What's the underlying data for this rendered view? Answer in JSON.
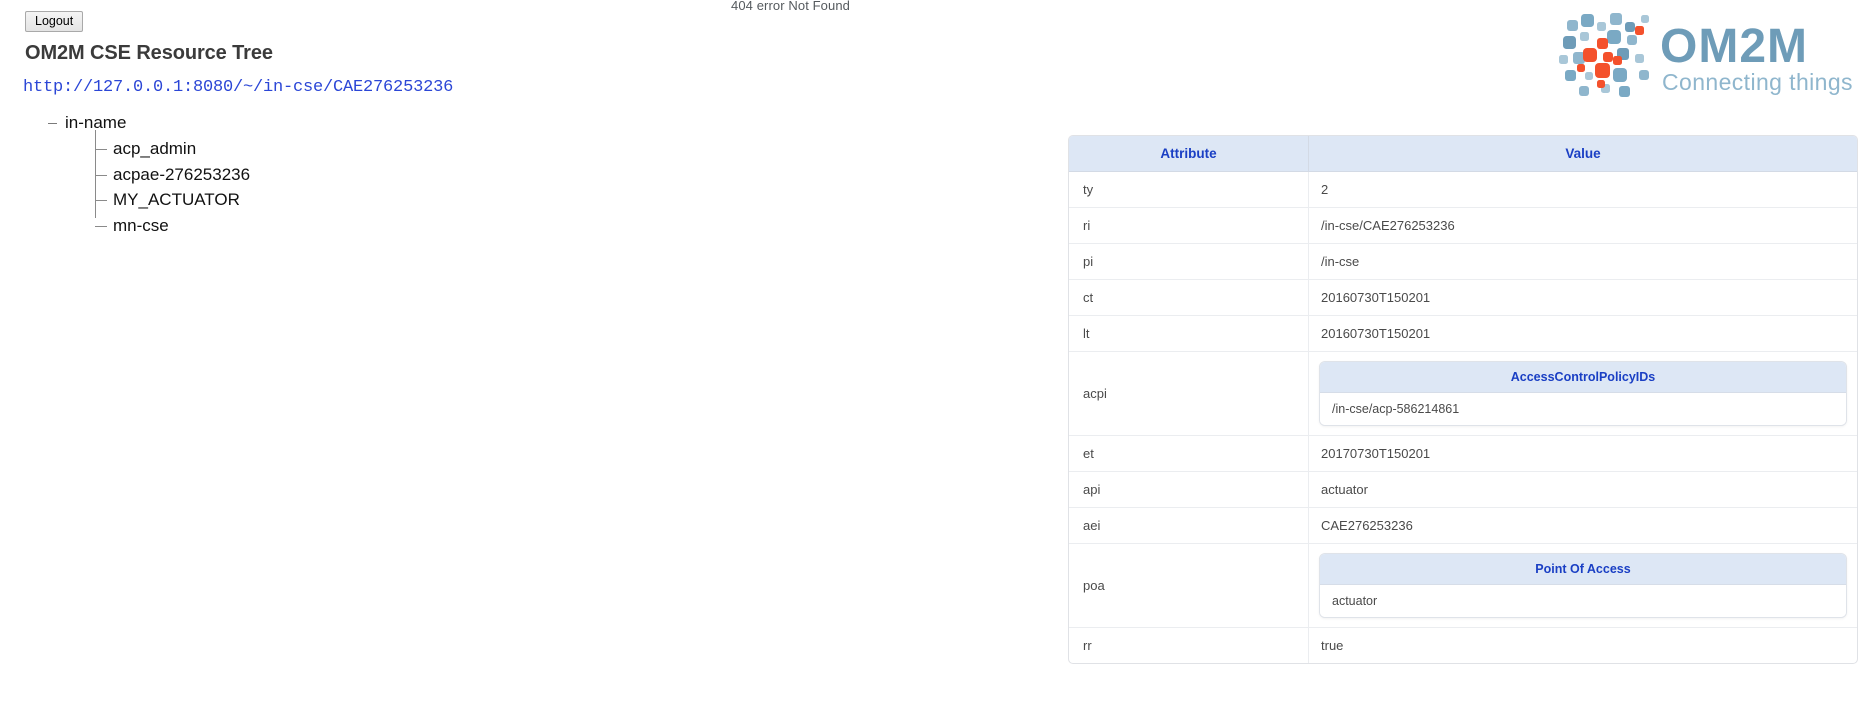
{
  "banner": {
    "error_text": "404 error Not Found"
  },
  "header": {
    "logout_label": "Logout",
    "page_title": "OM2M CSE Resource Tree",
    "cse_url": "http://127.0.0.1:8080/~/in-cse/CAE276253236"
  },
  "logo": {
    "wordmark": "OM2M",
    "tagline": "Connecting things",
    "blue": "#6e9cb8",
    "light_blue": "#8fb6cd",
    "orange": "#f4512c"
  },
  "tree": {
    "root": "in-name",
    "children": [
      {
        "label": "acp_admin"
      },
      {
        "label": "acpae-276253236"
      },
      {
        "label": "MY_ACTUATOR"
      },
      {
        "label": "mn-cse"
      }
    ]
  },
  "table": {
    "columns": [
      "Attribute",
      "Value"
    ],
    "rows": [
      {
        "attribute": "ty",
        "value": "2"
      },
      {
        "attribute": "ri",
        "value": "/in-cse/CAE276253236"
      },
      {
        "attribute": "pi",
        "value": "/in-cse"
      },
      {
        "attribute": "ct",
        "value": "20160730T150201"
      },
      {
        "attribute": "lt",
        "value": "20160730T150201"
      },
      {
        "attribute": "acpi",
        "sub_header": "AccessControlPolicyIDs",
        "sub_values": [
          "/in-cse/acp-586214861"
        ]
      },
      {
        "attribute": "et",
        "value": "20170730T150201"
      },
      {
        "attribute": "api",
        "value": "actuator"
      },
      {
        "attribute": "aei",
        "value": "CAE276253236"
      },
      {
        "attribute": "poa",
        "sub_header": "Point Of Access",
        "sub_values": [
          "actuator"
        ]
      },
      {
        "attribute": "rr",
        "value": "true"
      }
    ]
  },
  "colors": {
    "header_bg": "#dde7f5",
    "header_text": "#1a3fc4",
    "link": "#2b46d6",
    "border": "#e0e2e6"
  }
}
